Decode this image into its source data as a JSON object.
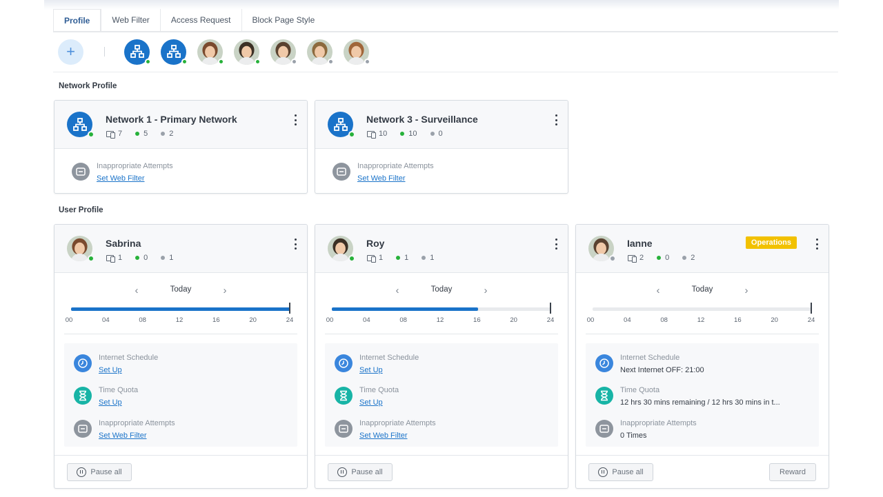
{
  "tabs": [
    "Profile",
    "Web Filter",
    "Access Request",
    "Block Page Style"
  ],
  "add_label": "+",
  "strip": [
    {
      "kind": "network",
      "status": "online"
    },
    {
      "kind": "network",
      "status": "online"
    },
    {
      "kind": "user",
      "name": "Sabrina",
      "status": "online",
      "color": "#7a4a2e"
    },
    {
      "kind": "user",
      "name": "Roy",
      "status": "online",
      "color": "#3c3025"
    },
    {
      "kind": "user",
      "name": "Ianne",
      "status": "offline",
      "color": "#5a4230"
    },
    {
      "kind": "user",
      "name": "",
      "status": "offline",
      "color": "#8c6a3e"
    },
    {
      "kind": "user",
      "name": "",
      "status": "offline",
      "color": "#a0663a"
    }
  ],
  "network_section": "Network Profile",
  "user_section": "User Profile",
  "networks": [
    {
      "name": "Network 1 - Primary Network",
      "devices": "7",
      "online": "5",
      "offline": "2",
      "row_label": "Inappropriate Attempts",
      "row_link": "Set Web Filter"
    },
    {
      "name": "Network 3 - Surveillance",
      "devices": "10",
      "online": "10",
      "offline": "0",
      "row_label": "Inappropriate Attempts",
      "row_link": "Set Web Filter"
    }
  ],
  "users": [
    {
      "name": "Sabrina",
      "devices": "1",
      "online": "0",
      "offline": "1",
      "status": "online",
      "badge": "",
      "day": "Today",
      "usage_hours": 24,
      "schedule_label": "Internet Schedule",
      "schedule_value": "Set Up",
      "quota_label": "Time Quota",
      "quota_value": "Set Up",
      "attempts_label": "Inappropriate Attempts",
      "attempts_value": "Set Web Filter",
      "pause_label": "Pause all",
      "reward_label": ""
    },
    {
      "name": "Roy",
      "devices": "1",
      "online": "1",
      "offline": "1",
      "status": "online",
      "badge": "",
      "day": "Today",
      "usage_hours": 16,
      "schedule_label": "Internet Schedule",
      "schedule_value": "Set Up",
      "quota_label": "Time Quota",
      "quota_value": "Set Up",
      "attempts_label": "Inappropriate Attempts",
      "attempts_value": "Set Web Filter",
      "pause_label": "Pause all",
      "reward_label": ""
    },
    {
      "name": "Ianne",
      "devices": "2",
      "online": "0",
      "offline": "2",
      "status": "offline",
      "badge": "Operations",
      "day": "Today",
      "usage_hours": 0,
      "schedule_label": "Internet Schedule",
      "schedule_value": "Next Internet OFF: 21:00",
      "quota_label": "Time Quota",
      "quota_value": "12 hrs 30 mins remaining / 12 hrs 30 mins in t...",
      "attempts_label": "Inappropriate Attempts",
      "attempts_value": "0 Times",
      "pause_label": "Pause all",
      "reward_label": "Reward"
    }
  ],
  "timeline_ticks": [
    "00",
    "04",
    "08",
    "12",
    "16",
    "20",
    "24"
  ],
  "colors": {
    "accent": "#1a73c9",
    "online": "#27b13a",
    "offline": "#9aa1aa",
    "badge": "#f2c100"
  }
}
